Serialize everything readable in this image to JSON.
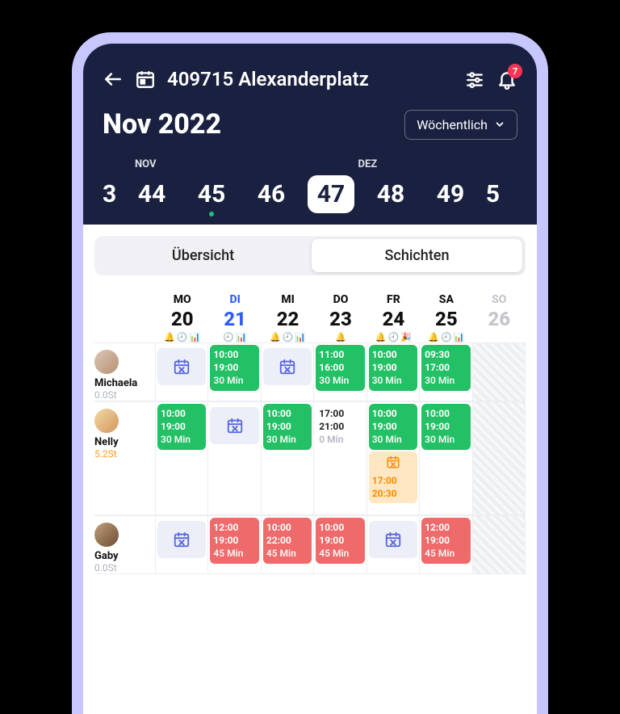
{
  "header": {
    "title": "409715 Alexanderplatz",
    "month_label": "Nov 2022",
    "view_label": "Wöchentlich",
    "notification_count": "7",
    "months": {
      "left": "NOV",
      "right": "DEZ"
    },
    "weeks": {
      "edge_left": "3",
      "items": [
        "44",
        "45",
        "46",
        "47",
        "48",
        "49"
      ],
      "selected": "47",
      "dot_on": "45",
      "edge_right": "5"
    }
  },
  "tabs": {
    "overview": "Übersicht",
    "shifts": "Schichten"
  },
  "days": [
    {
      "abbr": "MO",
      "num": "20",
      "today": false,
      "dim": false,
      "icons": [
        "bell",
        "clock",
        "bars"
      ]
    },
    {
      "abbr": "DI",
      "num": "21",
      "today": true,
      "dim": false,
      "icons": [
        "clock",
        "bars"
      ]
    },
    {
      "abbr": "MI",
      "num": "22",
      "today": false,
      "dim": false,
      "icons": [
        "bell",
        "clock",
        "bars"
      ]
    },
    {
      "abbr": "DO",
      "num": "23",
      "today": false,
      "dim": false,
      "icons": [
        "bell"
      ]
    },
    {
      "abbr": "FR",
      "num": "24",
      "today": false,
      "dim": false,
      "icons": [
        "bell",
        "clock",
        "party"
      ]
    },
    {
      "abbr": "SA",
      "num": "25",
      "today": false,
      "dim": false,
      "icons": [
        "bell",
        "clock",
        "bars"
      ]
    },
    {
      "abbr": "SO",
      "num": "26",
      "today": false,
      "dim": true,
      "icons": []
    }
  ],
  "employees": [
    {
      "name": "Michaela",
      "hours": "0.0St",
      "hours_color": "grey",
      "cells": [
        {
          "type": "placeholder"
        },
        {
          "type": "shift",
          "style": "green",
          "start": "10:00",
          "end": "19:00",
          "break": "30 Min"
        },
        {
          "type": "placeholder"
        },
        {
          "type": "shift",
          "style": "green",
          "start": "11:00",
          "end": "16:00",
          "break": "30 Min"
        },
        {
          "type": "shift",
          "style": "green",
          "start": "10:00",
          "end": "19:00",
          "break": "30 Min"
        },
        {
          "type": "shift",
          "style": "green",
          "start": "09:30",
          "end": "17:00",
          "break": "30 Min"
        },
        {
          "type": "stripes"
        }
      ]
    },
    {
      "name": "Nelly",
      "hours": "5.2St",
      "hours_color": "orange",
      "cells": [
        {
          "type": "shift",
          "style": "green",
          "start": "10:00",
          "end": "19:00",
          "break": "30 Min"
        },
        {
          "type": "placeholder"
        },
        {
          "type": "shift",
          "style": "green",
          "start": "10:00",
          "end": "19:00",
          "break": "30 Min"
        },
        {
          "type": "shift",
          "style": "white",
          "start": "17:00",
          "end": "21:00",
          "break": "0 Min",
          "break_dim": true
        },
        {
          "type": "stack",
          "items": [
            {
              "style": "green",
              "start": "10:00",
              "end": "19:00",
              "break": "30 Min"
            },
            {
              "style": "orange-soft",
              "icon": true,
              "start": "17:00",
              "end": "20:30"
            }
          ]
        },
        {
          "type": "shift",
          "style": "green",
          "start": "10:00",
          "end": "19:00",
          "break": "30 Min"
        },
        {
          "type": "stripes"
        }
      ]
    },
    {
      "name": "Gaby",
      "hours": "0.0St",
      "hours_color": "grey",
      "cells": [
        {
          "type": "placeholder"
        },
        {
          "type": "shift",
          "style": "red",
          "start": "12:00",
          "end": "19:00",
          "break": "45 Min"
        },
        {
          "type": "shift",
          "style": "red",
          "start": "10:00",
          "end": "22:00",
          "break": "45 Min"
        },
        {
          "type": "shift",
          "style": "red",
          "start": "10:00",
          "end": "19:00",
          "break": "45 Min"
        },
        {
          "type": "placeholder"
        },
        {
          "type": "shift",
          "style": "red",
          "start": "12:00",
          "end": "19:00",
          "break": "45 Min"
        },
        {
          "type": "stripes"
        }
      ]
    }
  ]
}
